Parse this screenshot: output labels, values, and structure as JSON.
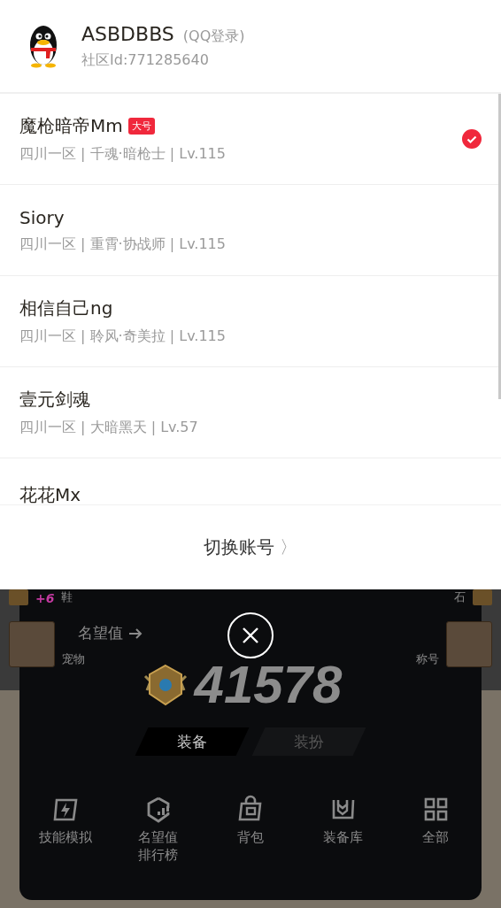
{
  "account": {
    "name": "ASBDBBS",
    "login_type": "(QQ登录)",
    "community_id": "社区Id:771285640"
  },
  "roles": [
    {
      "name": "魔枪暗帝Mm",
      "badge": "大号",
      "info": "四川一区 | 千魂·暗枪士 | Lv.115",
      "selected": true
    },
    {
      "name": "Siory",
      "info": "四川一区 | 重霄·协战师 | Lv.115",
      "selected": false
    },
    {
      "name": "相信自己ng",
      "info": "四川一区 | 聆风·奇美拉 | Lv.115",
      "selected": false
    },
    {
      "name": "壹元剑魂",
      "info": "四川一区 | 大暗黑天 | Lv.57",
      "selected": false
    },
    {
      "name": "花花Mx",
      "selected": false
    }
  ],
  "switch_account": {
    "label": "切换账号",
    "chevron": "〉"
  },
  "background": {
    "side_items": [
      {
        "label": "鞋",
        "badge": "+6"
      },
      {
        "label": "宠物"
      },
      {
        "label": "石"
      },
      {
        "label": "称号"
      }
    ],
    "fame": {
      "label": "名望值",
      "value": "41578"
    },
    "tabs": [
      {
        "label": "装备",
        "selected": true
      },
      {
        "label": "装扮",
        "selected": false
      }
    ],
    "menu": [
      {
        "kind": "skill",
        "label_lines": [
          "技能模拟"
        ]
      },
      {
        "kind": "ranking",
        "label_lines": [
          "名望值",
          "排行榜"
        ]
      },
      {
        "kind": "bag",
        "label_lines": [
          "背包"
        ]
      },
      {
        "kind": "vault",
        "label_lines": [
          "装备库"
        ]
      },
      {
        "kind": "all",
        "label_lines": [
          "全部"
        ]
      }
    ]
  }
}
